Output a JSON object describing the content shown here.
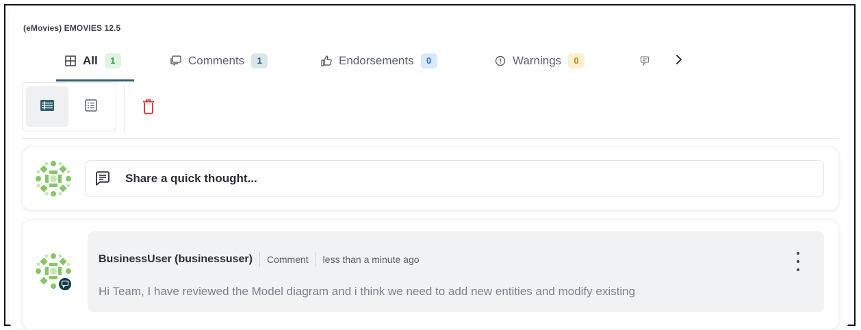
{
  "entity": {
    "title": "(eMovies) EMOVIES 12.5"
  },
  "tabs": [
    {
      "label": "All",
      "count": "1",
      "icon": "grid-icon"
    },
    {
      "label": "Comments",
      "count": "1",
      "icon": "comments-icon"
    },
    {
      "label": "Endorsements",
      "count": "0",
      "icon": "thumbs-up-icon"
    },
    {
      "label": "Warnings",
      "count": "0",
      "icon": "warning-icon"
    },
    {
      "label": "",
      "icon": "thumbs-down-icon"
    }
  ],
  "tabs_scroll": {
    "icon": "chevron-right-icon"
  },
  "toolbar": {
    "view_list_icon": "list-view-icon",
    "view_compact_icon": "compact-view-icon",
    "delete_icon": "trash-icon"
  },
  "composer": {
    "placeholder": "Share a quick thought...",
    "icon": "message-icon"
  },
  "comments": [
    {
      "author": "BusinessUser (businessuser)",
      "type": "Comment",
      "time": "less than a minute ago",
      "text": "Hi Team, I have reviewed the Model diagram and i think we need to add new entities and modify existing"
    }
  ],
  "colors": {
    "accent": "#2f5f6d",
    "trash": "#e0393e",
    "badge_green": "#dff5e1",
    "badge_teal": "#d9e6ea",
    "badge_blue": "#d9e9fb",
    "badge_yellow": "#fbf0cf",
    "avatar_green": "#7cc35a"
  }
}
